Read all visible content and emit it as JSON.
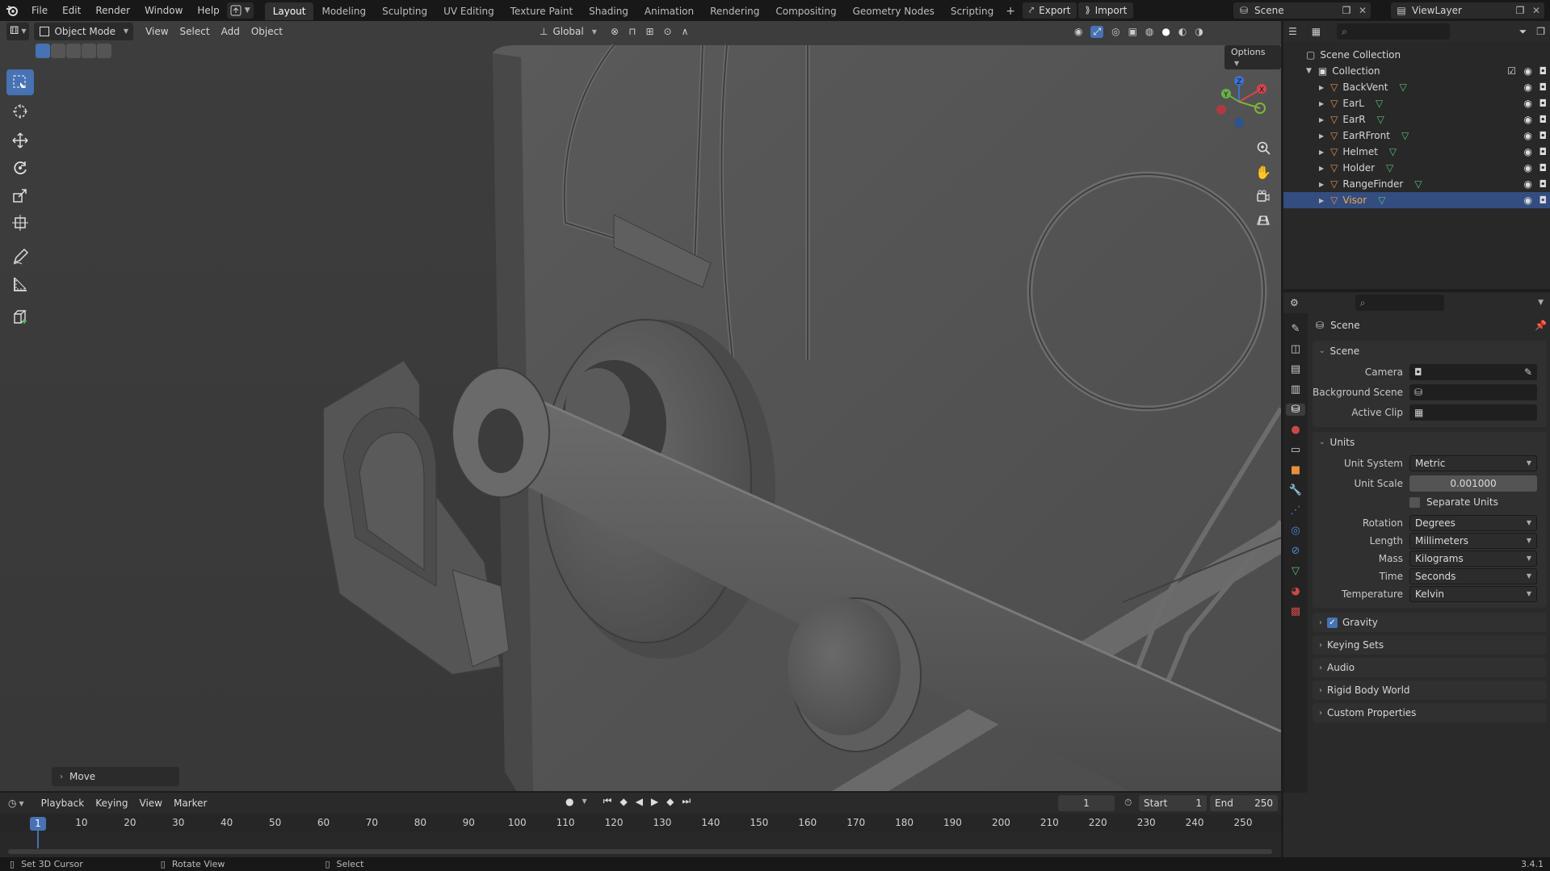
{
  "topbar": {
    "menus": [
      "File",
      "Edit",
      "Render",
      "Window",
      "Help"
    ],
    "workspaces": [
      "Layout",
      "Modeling",
      "Sculpting",
      "UV Editing",
      "Texture Paint",
      "Shading",
      "Animation",
      "Rendering",
      "Compositing",
      "Geometry Nodes",
      "Scripting"
    ],
    "active_workspace": "Layout",
    "add_tab": "+",
    "export_label": "Export",
    "import_label": "Import",
    "scene_name": "Scene",
    "view_layer": "ViewLayer"
  },
  "viewport": {
    "mode": "Object Mode",
    "menus": [
      "View",
      "Select",
      "Add",
      "Object"
    ],
    "transform_orientation": "Global",
    "options_label": "Options",
    "last_operator": "Move"
  },
  "outliner": {
    "root": "Scene Collection",
    "collection": "Collection",
    "objects": [
      "BackVent",
      "EarL",
      "EarR",
      "EarRFront",
      "Helmet",
      "Holder",
      "RangeFinder",
      "Visor"
    ],
    "selected": "Visor"
  },
  "properties": {
    "title": "Scene",
    "scene_section": "Scene",
    "camera_label": "Camera",
    "background_scene_label": "Background Scene",
    "active_clip_label": "Active Clip",
    "units_section": "Units",
    "unit_system_label": "Unit System",
    "unit_system": "Metric",
    "unit_scale_label": "Unit Scale",
    "unit_scale": "0.001000",
    "separate_units_label": "Separate Units",
    "rotation_label": "Rotation",
    "rotation": "Degrees",
    "length_label": "Length",
    "length": "Millimeters",
    "mass_label": "Mass",
    "mass": "Kilograms",
    "time_label": "Time",
    "time": "Seconds",
    "temperature_label": "Temperature",
    "temperature": "Kelvin",
    "gravity_label": "Gravity",
    "collapsed_sections": [
      "Keying Sets",
      "Audio",
      "Rigid Body World",
      "Custom Properties"
    ]
  },
  "timeline": {
    "menus": [
      "Playback",
      "Keying",
      "View",
      "Marker"
    ],
    "current_frame": "1",
    "start_label": "Start",
    "start": "1",
    "end_label": "End",
    "end": "250",
    "ticks": [
      "1",
      "10",
      "20",
      "30",
      "40",
      "50",
      "60",
      "70",
      "80",
      "90",
      "100",
      "110",
      "120",
      "130",
      "140",
      "150",
      "160",
      "170",
      "180",
      "190",
      "200",
      "210",
      "220",
      "230",
      "240",
      "250"
    ]
  },
  "statusbar": {
    "hint1": "Set 3D Cursor",
    "hint2": "Rotate View",
    "hint3": "Select",
    "version": "3.4.1"
  },
  "colors": {
    "accent": "#4772b3",
    "object_orange": "#e6913a",
    "mesh_green": "#5fbf7a",
    "viewport_bg": "#3a3a3a"
  }
}
